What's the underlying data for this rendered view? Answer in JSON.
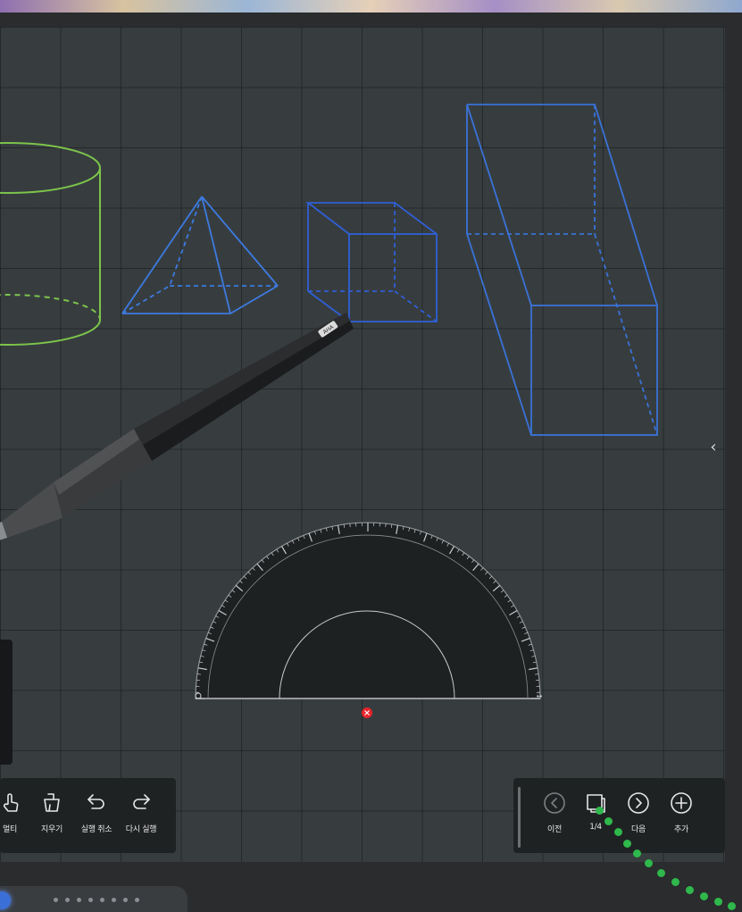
{
  "app": {
    "device": "interactive display",
    "pen_logo": "AHA"
  },
  "toolbar_left": {
    "items": [
      {
        "label": "멀티",
        "icon": "multi-touch-icon"
      },
      {
        "label": "지우기",
        "icon": "eraser-icon"
      },
      {
        "label": "실행 취소",
        "icon": "undo-icon"
      },
      {
        "label": "다시 실행",
        "icon": "redo-icon"
      }
    ]
  },
  "toolbar_right": {
    "items": [
      {
        "label": "이전",
        "icon": "prev-page-icon"
      },
      {
        "label": "1/4",
        "icon": "page-thumbnail-icon"
      },
      {
        "label": "다음",
        "icon": "next-page-icon"
      },
      {
        "label": "추가",
        "icon": "add-page-icon"
      }
    ],
    "page_current": 1,
    "page_total": 4
  },
  "side_panel": {
    "collapse_glyph": "‹"
  },
  "colors": {
    "board_background": "#373d3f",
    "cylinder_stroke": "#7cc44b",
    "pyramid_stroke": "#3d7ae0",
    "cube_stroke": "#2f5fd6",
    "prism_stroke": "#3a72d8",
    "protractor_fill": "#1e2122",
    "close_marker": "#e8232b",
    "cursor_dots": "#2fb84b"
  }
}
